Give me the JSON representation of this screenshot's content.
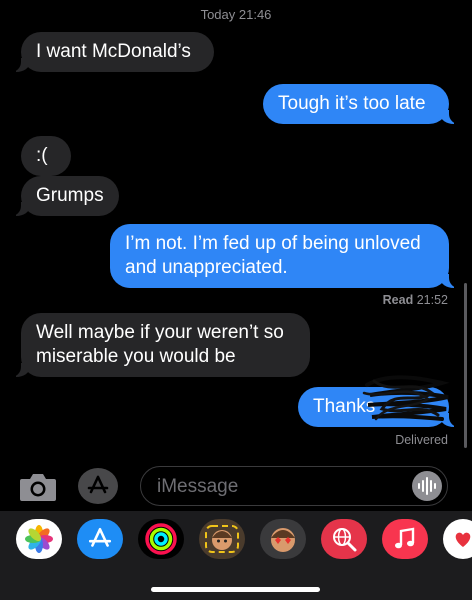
{
  "header": {
    "timestamp": "Today 21:46"
  },
  "messages": [
    {
      "id": "m1",
      "direction": "incoming",
      "text": "I want McDonald’s"
    },
    {
      "id": "m2",
      "direction": "outgoing",
      "text": "Tough it’s too late"
    },
    {
      "id": "m3",
      "direction": "incoming",
      "text": ":("
    },
    {
      "id": "m4",
      "direction": "incoming",
      "text": "Grumps"
    },
    {
      "id": "m5",
      "direction": "outgoing",
      "text": "I’m not. I’m fed up of being unloved and unappreciated."
    },
    {
      "id": "m6",
      "direction": "incoming",
      "text": "Well maybe if your weren’t so miserable you would be"
    },
    {
      "id": "m7",
      "direction": "outgoing",
      "text": "Thanks"
    }
  ],
  "receipts": {
    "read_label": "Read",
    "read_time": "21:52",
    "delivered": "Delivered"
  },
  "input_bar": {
    "placeholder": "iMessage",
    "value": ""
  },
  "app_drawer": {
    "apps": [
      {
        "name": "photos-app",
        "icon": "photos-icon"
      },
      {
        "name": "app-store",
        "icon": "app-store-icon"
      },
      {
        "name": "activity",
        "icon": "activity-rings-icon"
      },
      {
        "name": "memoji",
        "icon": "memoji-icon"
      },
      {
        "name": "memoji-stickers",
        "icon": "memoji-hearts-icon"
      },
      {
        "name": "images-search",
        "icon": "globe-search-icon"
      },
      {
        "name": "music",
        "icon": "music-note-icon"
      },
      {
        "name": "digital-touch",
        "icon": "heart-hand-icon"
      }
    ]
  },
  "colors": {
    "outgoing_bubble": "#2f86f6",
    "incoming_bubble": "#262628",
    "background": "#000000",
    "meta_text": "#8e8e93"
  }
}
